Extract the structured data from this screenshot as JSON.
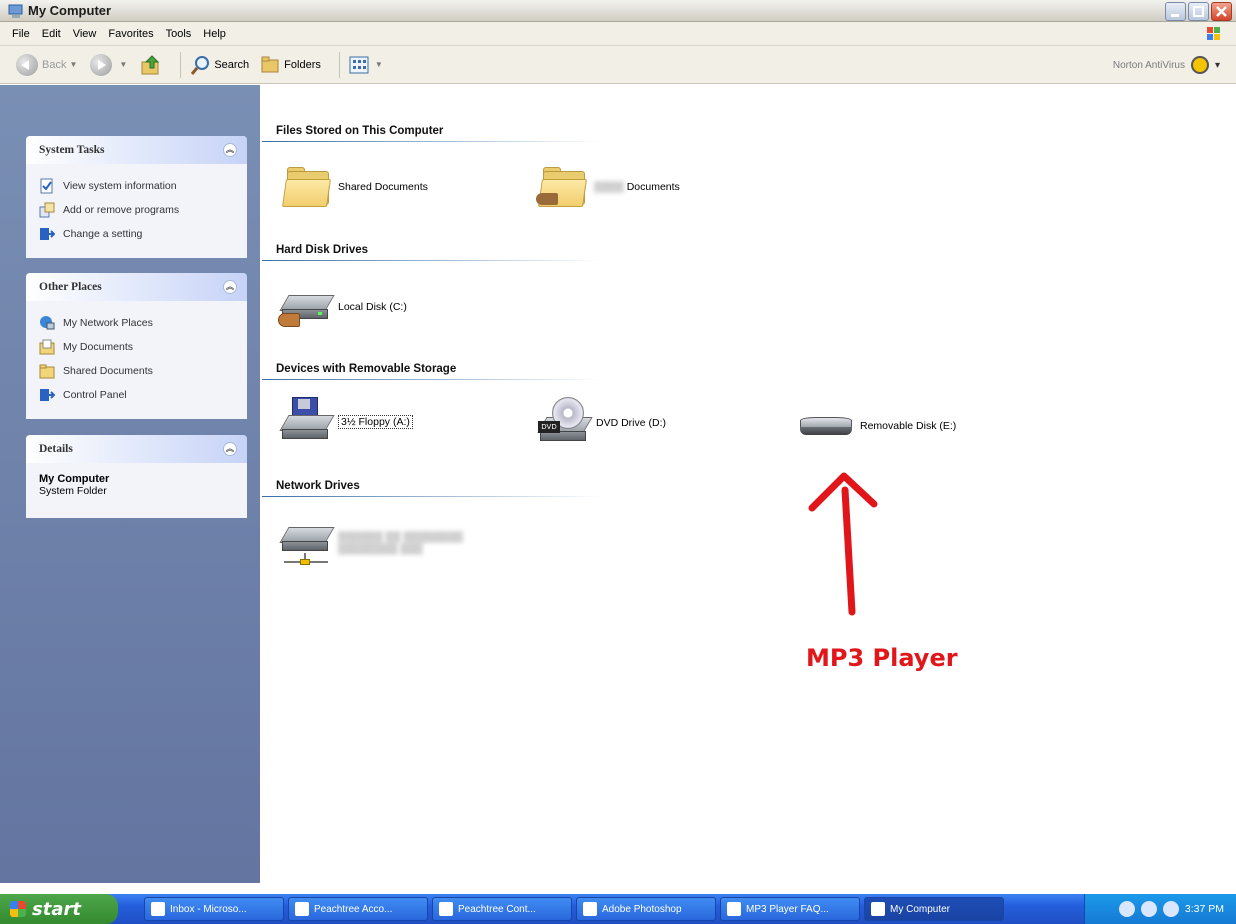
{
  "window": {
    "title": "My Computer"
  },
  "menu": [
    "File",
    "Edit",
    "View",
    "Favorites",
    "Tools",
    "Help"
  ],
  "toolbar": {
    "back": "Back",
    "search": "Search",
    "folders": "Folders",
    "norton": "Norton AntiVirus"
  },
  "left_pane": {
    "system_tasks": {
      "title": "System Tasks",
      "items": [
        "View system information",
        "Add or remove programs",
        "Change a setting"
      ]
    },
    "other_places": {
      "title": "Other Places",
      "items": [
        "My Network Places",
        "My Documents",
        "Shared Documents",
        "Control Panel"
      ]
    },
    "details": {
      "title": "Details",
      "name": "My Computer",
      "type": "System Folder"
    }
  },
  "content": {
    "groups": {
      "files": "Files Stored on This Computer",
      "hard": "Hard Disk Drives",
      "removable": "Devices with Removable Storage",
      "network": "Network Drives"
    },
    "items": {
      "shared_docs": "Shared Documents",
      "user_docs_suffix": "Documents",
      "local_disk": "Local Disk (C:)",
      "floppy": "3½ Floppy (A:)",
      "dvd": "DVD Drive (D:)",
      "dvd_tag": "DVD",
      "removable_disk": "Removable Disk (E:)"
    }
  },
  "annotation": {
    "text": "MP3 Player",
    "color": "#e0161a"
  },
  "taskbar": {
    "start": "start",
    "tasks": [
      "Inbox - Microso...",
      "Peachtree Acco...",
      "Peachtree Cont...",
      "Adobe Photoshop",
      "MP3 Player FAQ...",
      "My Computer"
    ],
    "clock": "3:37 PM"
  }
}
